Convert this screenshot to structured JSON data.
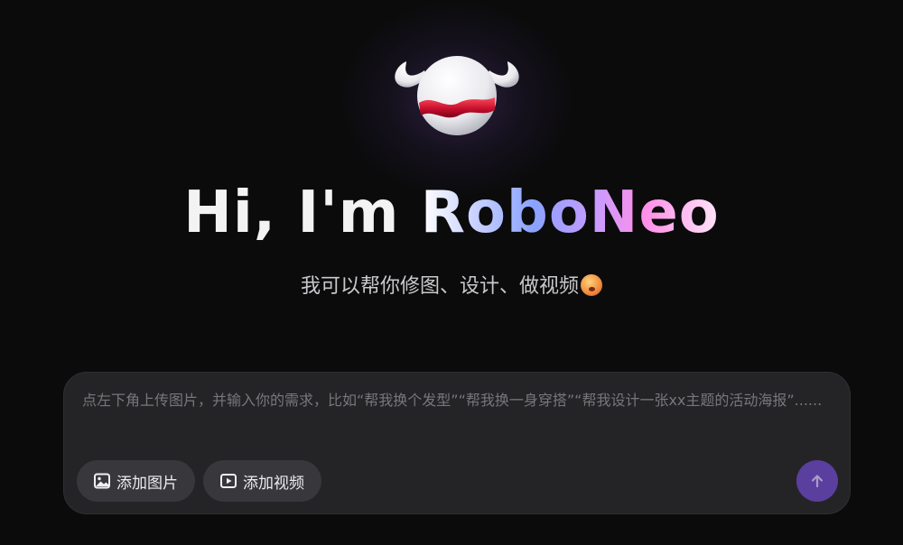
{
  "hero": {
    "greeting": "Hi, I'm ",
    "brand_name": "RoboNeo",
    "tagline": "我可以帮你修图、设计、做视频",
    "logo_icon": "roboneo-mascot-icon",
    "emoji_icon": "star-struck-emoji-icon"
  },
  "composer": {
    "placeholder": "点左下角上传图片，并输入你的需求，比如“帮我换个发型”“帮我换一身穿搭”“帮我设计一张xx主题的活动海报”......",
    "add_image_label": "添加图片",
    "add_image_icon": "image-icon",
    "add_video_label": "添加视频",
    "add_video_icon": "play-icon",
    "send_icon": "arrow-up-icon"
  },
  "colors": {
    "background": "#0b0b0c",
    "composer_bg": "#242427",
    "chip_bg": "#38383c",
    "send_button": "#5a3f9e",
    "accent_gradient": [
      "#c9d2ff",
      "#8aa2ff",
      "#c79bff",
      "#ff8fe8"
    ]
  }
}
